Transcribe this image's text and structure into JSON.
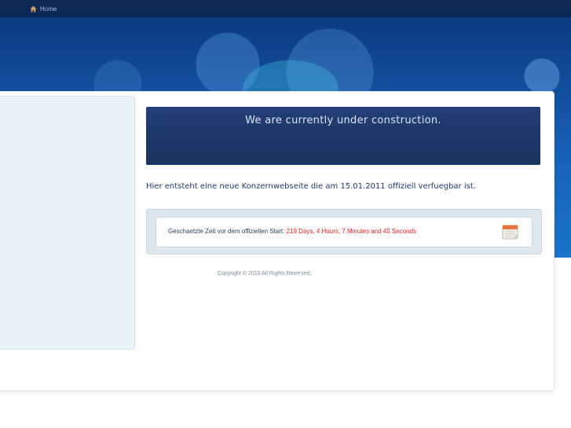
{
  "nav": {
    "home_label": "Home"
  },
  "content": {
    "headline": "We are currently under construction.",
    "intro": "Hier entsteht eine neue Konzernwebseite die am 15.01.2011 offiziell verfuegbar ist.",
    "countdown_label": "Geschaetzte Zeit vor dem offiziellen Start:",
    "countdown_value": "219 Days, 4 Hours, 7 Minutes and 45 Seconds"
  },
  "footer": {
    "copyright": "Copyright © 2010 All Rights Reserved."
  },
  "colors": {
    "topbar": "#0c2a55",
    "banner": "#1760b8",
    "headline_box": "#1d3867",
    "countdown_value": "#e02020",
    "sidebar": "#e8f2f9"
  },
  "icons": {
    "home": "home-icon",
    "calendar": "calendar-icon"
  }
}
